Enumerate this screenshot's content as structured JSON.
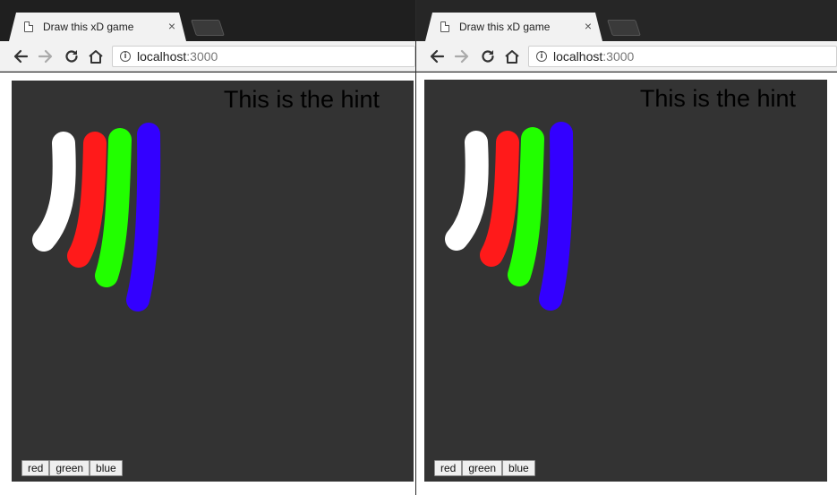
{
  "windows": [
    {
      "tab": {
        "title": "Draw this xD game",
        "close_glyph": "×"
      },
      "url": {
        "host": "localhost",
        "port": ":3000"
      },
      "hint": "This is the hint",
      "buttons": {
        "red": "red",
        "green": "green",
        "blue": "blue"
      }
    },
    {
      "tab": {
        "title": "Draw this xD game",
        "close_glyph": "×"
      },
      "url": {
        "host": "localhost",
        "port": ":3000"
      },
      "hint": "This is the hint",
      "buttons": {
        "red": "red",
        "green": "green",
        "blue": "blue"
      }
    }
  ],
  "stroke_colors": {
    "white": "#ffffff",
    "red": "#ff1a1a",
    "green": "#22ff00",
    "blue": "#3300ff"
  },
  "canvas_bg": "#333333",
  "icons": [
    "page-icon",
    "close-icon",
    "new-tab-icon",
    "back-arrow-icon",
    "forward-arrow-icon",
    "reload-icon",
    "home-icon",
    "info-icon"
  ]
}
